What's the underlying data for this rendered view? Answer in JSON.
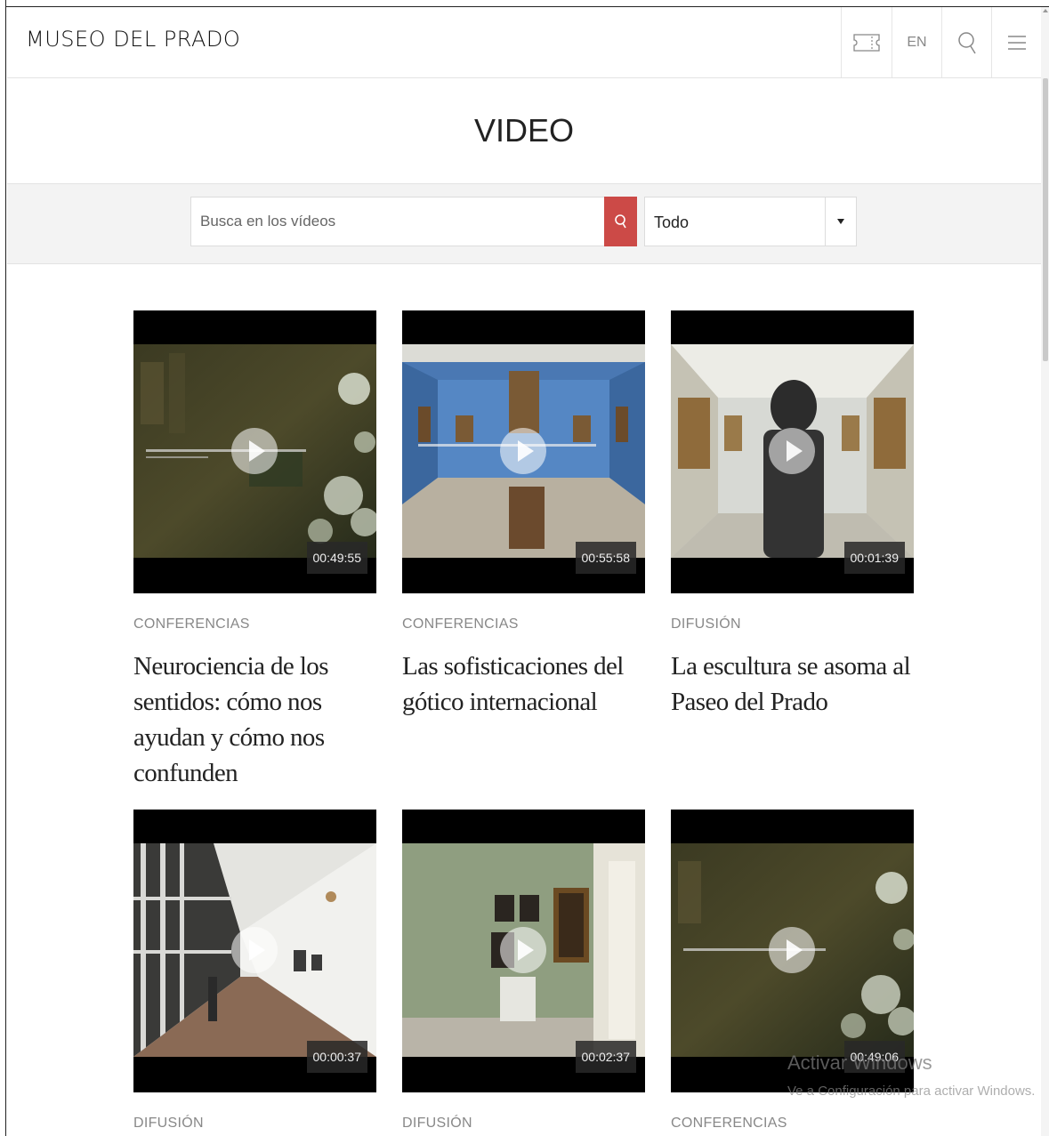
{
  "header": {
    "logo": "MUSEO DEL PRADO",
    "language": "EN",
    "icons": [
      "ticket-icon",
      "search-icon",
      "menu-icon"
    ]
  },
  "page": {
    "title": "VIDEO"
  },
  "filters": {
    "search_placeholder": "Busca en los vídeos",
    "select_value": "Todo",
    "search_button_color": "#cc4a47"
  },
  "videos": [
    {
      "category": "CONFERENCIAS",
      "title": "Neurociencia de los sentidos: cómo nos ayudan y cómo nos confunden",
      "duration": "00:49:55"
    },
    {
      "category": "CONFERENCIAS",
      "title": "Las sofisticaciones del gótico internacional",
      "duration": "00:55:58"
    },
    {
      "category": "DIFUSIÓN",
      "title": "La escultura se asoma al Paseo del Prado",
      "duration": "00:01:39"
    },
    {
      "category": "DIFUSIÓN",
      "title": "",
      "duration": "00:00:37"
    },
    {
      "category": "DIFUSIÓN",
      "title": "",
      "duration": "00:02:37"
    },
    {
      "category": "CONFERENCIAS",
      "title": "",
      "duration": "00:49:06"
    }
  ],
  "watermark": {
    "line1": "Activar Windows",
    "line2": "Ve a Configuración para activar Windows."
  }
}
